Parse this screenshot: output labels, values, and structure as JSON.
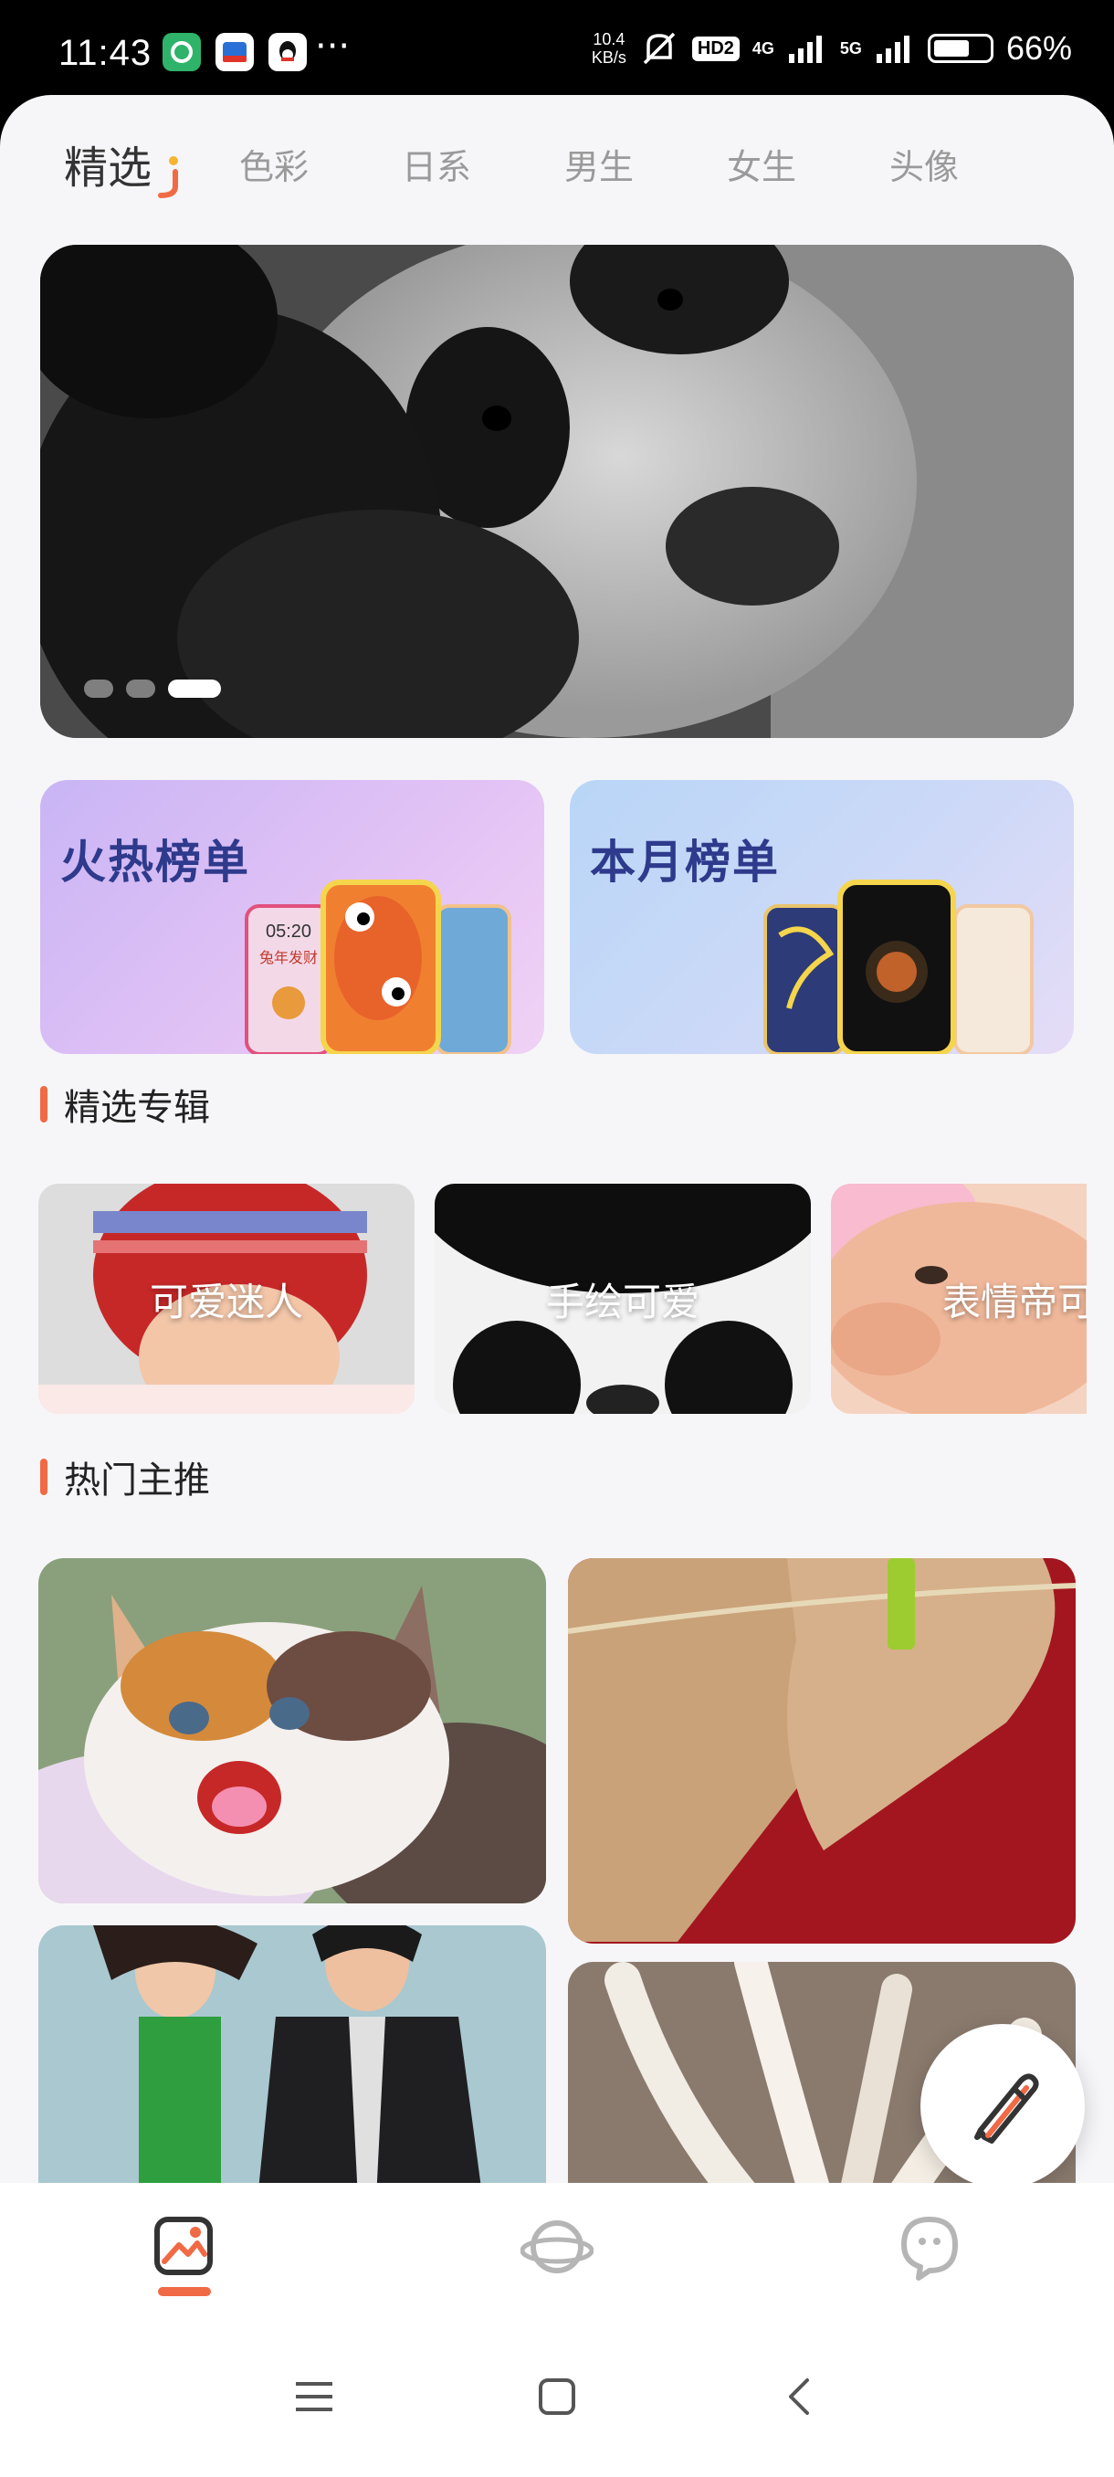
{
  "status_bar": {
    "time": "11:43",
    "net_speed_value": "10.4",
    "net_speed_unit": "KB/s",
    "hd_badge": "HD2",
    "net_4g": "4G",
    "net_5g": "5G",
    "battery_percent": "66%",
    "battery_level": 0.66,
    "more": "···"
  },
  "tabs": [
    {
      "label": "精选",
      "active": true
    },
    {
      "label": "色彩"
    },
    {
      "label": "日系"
    },
    {
      "label": "男生"
    },
    {
      "label": "女生"
    },
    {
      "label": "头像"
    }
  ],
  "banner": {
    "dots": 3,
    "active_dot": 3
  },
  "rank_cards": [
    {
      "title": "火热榜单",
      "phone_time": "05:20",
      "phone_text": "兔年发财"
    },
    {
      "title": "本月榜单"
    }
  ],
  "sections": {
    "albums_title": "精选专辑",
    "hot_title": "热门主推"
  },
  "albums": [
    {
      "label": "可爱迷人"
    },
    {
      "label": "手绘可爱"
    },
    {
      "label": "表情帝可"
    }
  ],
  "colors": {
    "accent": "#f06a45",
    "rank_title": "#2e3a8c",
    "background": "#f6f6f8"
  },
  "icons": {
    "fab": "pen-icon",
    "nav": [
      "wallpaper-icon",
      "planet-icon",
      "chat-face-icon"
    ],
    "system": [
      "menu-icon",
      "home-icon",
      "back-icon"
    ]
  }
}
